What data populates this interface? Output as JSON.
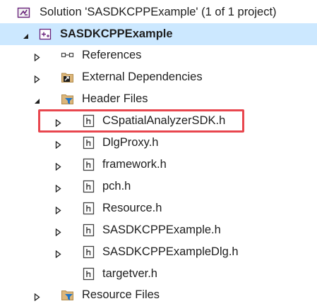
{
  "colors": {
    "selection": "#cce8ff",
    "highlight_border": "#e8464e",
    "folder": "#dcb67a",
    "filter_blue": "#1e74c8",
    "solution_purple": "#68217a"
  },
  "tree": {
    "solution_label": "Solution 'SASDKCPPExample' (1 of 1 project)",
    "project_label": "SASDKCPPExample",
    "items": {
      "references": "References",
      "external_deps": "External Dependencies",
      "header_files": "Header Files",
      "resource_files": "Resource Files"
    },
    "headers": [
      "CSpatialAnalyzerSDK.h",
      "DlgProxy.h",
      "framework.h",
      "pch.h",
      "Resource.h",
      "SASDKCPPExample.h",
      "SASDKCPPExampleDlg.h",
      "targetver.h"
    ]
  },
  "icons": {
    "solution": "visual-studio-solution-icon",
    "project": "cpp-project-icon",
    "references": "references-icon",
    "external_deps": "external-dependencies-icon",
    "filter_folder": "filter-folder-icon",
    "header_file": "header-file-icon",
    "expanded": "expanded-triangle-icon",
    "collapsed": "collapsed-triangle-icon"
  }
}
